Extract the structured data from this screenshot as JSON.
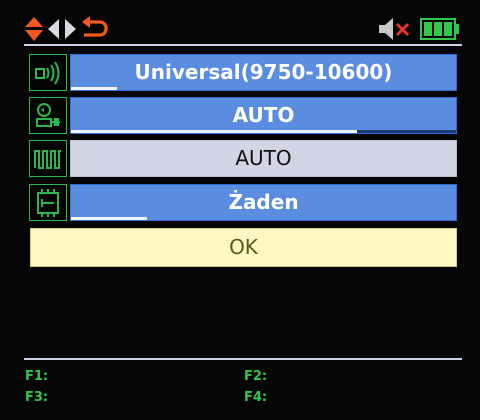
{
  "statusbar": {
    "left_icons": [
      "up-down-arrows-icon",
      "left-right-arrows-icon",
      "back-return-icon"
    ],
    "right_icons": [
      "mute-speaker-icon",
      "battery-icon"
    ],
    "colors": {
      "accent": "#f05a1e",
      "battery": "#2fc84a",
      "mute_x": "#e8322a",
      "speaker": "#c8c8c8"
    }
  },
  "settings": [
    {
      "icon": "lnb-signal-icon",
      "value": "Universal(9750-10600)",
      "style": "blue",
      "progress": 0.12
    },
    {
      "icon": "satellite-dish-power-icon",
      "value": "AUTO",
      "style": "blue",
      "progress": 0.74
    },
    {
      "icon": "22khz-tone-icon",
      "value": "AUTO",
      "style": "light",
      "progress": 0.0
    },
    {
      "icon": "diseqc-switch-icon",
      "value": "Żaden",
      "style": "blue",
      "progress": 0.2
    }
  ],
  "ok_button": {
    "label": "OK"
  },
  "function_keys": {
    "f1": "F1:",
    "f2": "F2:",
    "f3": "F3:",
    "f4": "F4:"
  },
  "colors": {
    "field_blue": "#5a8de0",
    "field_light": "#d0d6e4",
    "icon_border": "#2bb84a",
    "ok_background": "#fff7c4",
    "fkey_text": "#2fc84a"
  }
}
